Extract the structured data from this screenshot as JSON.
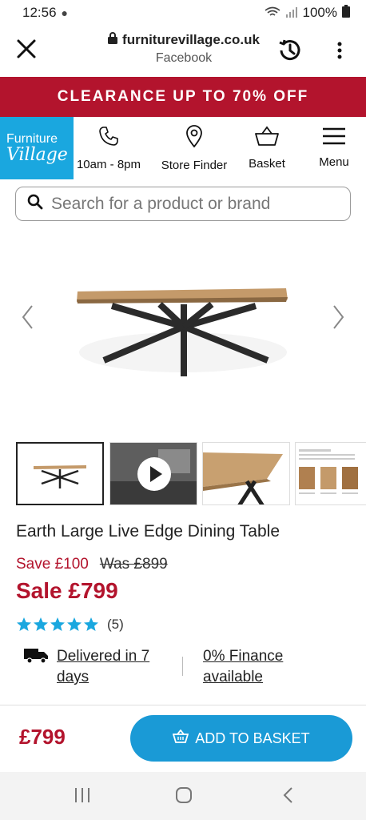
{
  "status_bar": {
    "time": "12:56",
    "battery": "100%"
  },
  "browser": {
    "url": "furniturevillage.co.uk",
    "source": "Facebook"
  },
  "banner": {
    "text": "CLEARANCE UP TO 70% OFF"
  },
  "header": {
    "logo_top": "Furniture",
    "logo_bottom": "Village",
    "hours": "10am - 8pm",
    "store_finder": "Store Finder",
    "basket": "Basket",
    "menu": "Menu"
  },
  "search": {
    "placeholder": "Search for a product or brand"
  },
  "product": {
    "title": "Earth Large Live Edge Dining Table",
    "save": "Save £100",
    "was": "Was £899",
    "sale": "Sale £799",
    "rating": 5,
    "review_count": "(5)",
    "delivery": "Delivered in 7 days",
    "delivery_line1": "Delivered in 7",
    "delivery_line2": "days",
    "finance_line1": "0% Finance",
    "finance_line2": "available"
  },
  "sticky": {
    "price": "£799",
    "add_label": "ADD TO BASKET"
  },
  "colors": {
    "brand_red": "#b3142d",
    "brand_blue": "#1aa7df",
    "button_blue": "#1a9ad6",
    "star_blue": "#1aa7df"
  }
}
